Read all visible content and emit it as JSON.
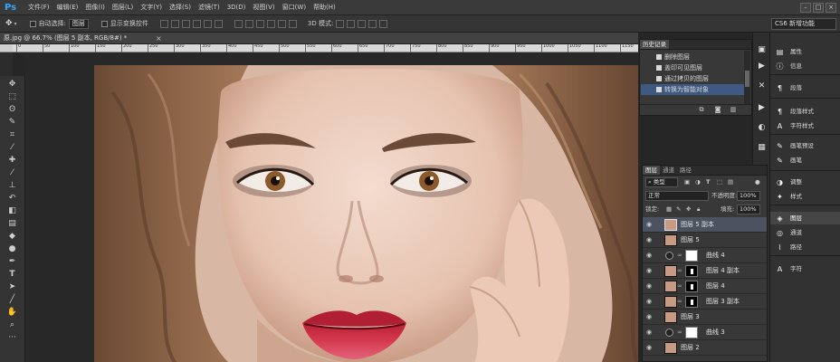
{
  "app": {
    "logo": "Ps"
  },
  "menu": [
    "文件(F)",
    "编辑(E)",
    "图像(I)",
    "图层(L)",
    "文字(Y)",
    "选择(S)",
    "滤镜(T)",
    "3D(D)",
    "视图(V)",
    "窗口(W)",
    "帮助(H)"
  ],
  "window_controls": {
    "minimize": "–",
    "maximize": "□",
    "close": "×"
  },
  "options_bar": {
    "auto_select_label": "自动选择:",
    "auto_select_value": "图层",
    "show_transform_label": "显示变换控件",
    "mode_3d_label": "3D 模式:",
    "workspace": "CS6 新增功能"
  },
  "document": {
    "tab_title": "原.jpg @ 66.7% (图层 5 副本, RGB/8#) *",
    "tab_close": "×"
  },
  "ruler": {
    "h_ticks": [
      "0",
      "50",
      "100",
      "150",
      "200",
      "250",
      "300",
      "350",
      "400",
      "450",
      "500",
      "550",
      "600",
      "650",
      "700",
      "750",
      "800",
      "850",
      "900",
      "950",
      "1000",
      "1050",
      "1100",
      "1150"
    ]
  },
  "history_panel": {
    "tabs": [
      "历史记录"
    ],
    "items": [
      "删除图层",
      "盖印可见图层",
      "通过拷贝的图层",
      "转换为智能对象"
    ],
    "selected_index": 3
  },
  "right_panels": [
    {
      "label": "属性",
      "icon": "properties-icon"
    },
    {
      "label": "信息",
      "icon": "info-icon"
    },
    {
      "label": "段落",
      "icon": "paragraph-icon"
    },
    {
      "label": "段落样式",
      "icon": "paragraph-styles-icon"
    },
    {
      "label": "字符样式",
      "icon": "character-styles-icon"
    },
    {
      "label": "画笔预设",
      "icon": "brush-presets-icon"
    },
    {
      "label": "画笔",
      "icon": "brush-icon"
    },
    {
      "label": "调整",
      "icon": "adjustments-icon"
    },
    {
      "label": "样式",
      "icon": "styles-icon"
    },
    {
      "label": "图层",
      "icon": "layers-icon"
    },
    {
      "label": "通道",
      "icon": "channels-icon"
    },
    {
      "label": "路径",
      "icon": "paths-icon"
    },
    {
      "label": "字符",
      "icon": "character-icon"
    }
  ],
  "layers_panel": {
    "tabs": [
      "图层",
      "通道",
      "路径"
    ],
    "filter_type": "类型",
    "blend_mode": "正常",
    "opacity_label": "不透明度:",
    "opacity_value": "100%",
    "lock_label": "锁定:",
    "fill_label": "填充:",
    "fill_value": "100%",
    "layers": [
      {
        "name": "图层 5 副本",
        "kind": "smart",
        "selected": true
      },
      {
        "name": "图层 5",
        "kind": "pixel"
      },
      {
        "name": "曲线 4",
        "kind": "curves"
      },
      {
        "name": "图层 4 副本",
        "kind": "masked"
      },
      {
        "name": "图层 4",
        "kind": "masked"
      },
      {
        "name": "图层 3 副本",
        "kind": "masked"
      },
      {
        "name": "图层 3",
        "kind": "pixel"
      },
      {
        "name": "曲线 3",
        "kind": "curves"
      },
      {
        "name": "图层 2",
        "kind": "pixel"
      }
    ]
  },
  "colors": {
    "selection_blue": "#3f5a82",
    "ps_blue": "#33a6ff",
    "lip_red": "#c8243a"
  }
}
